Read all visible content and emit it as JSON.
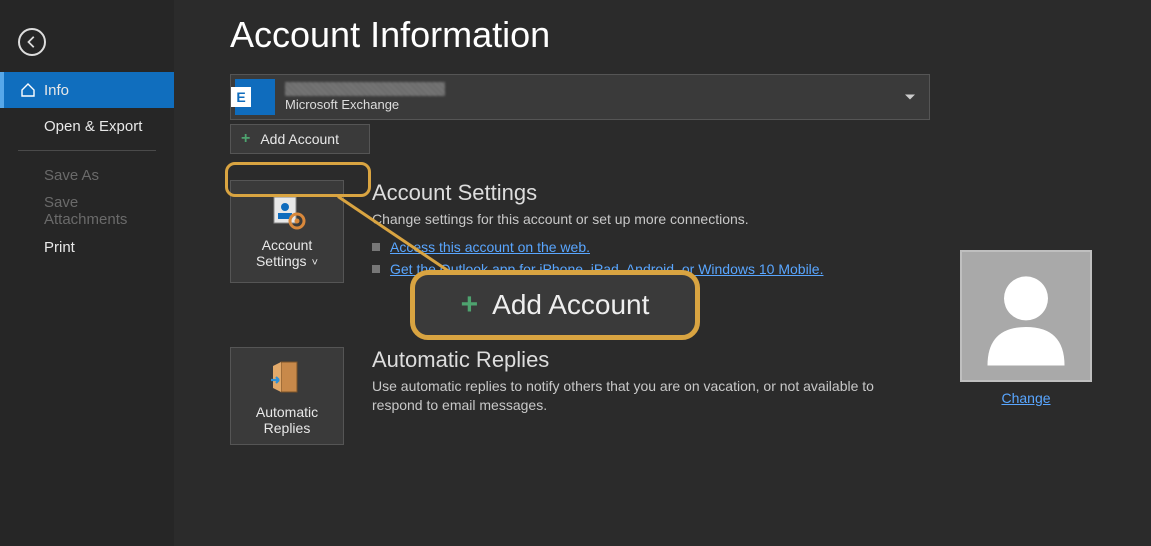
{
  "sidebar": {
    "items": [
      {
        "label": "Info",
        "selected": true,
        "icon": "home-icon"
      },
      {
        "label": "Open & Export"
      },
      {
        "label": "Save As",
        "disabled": true
      },
      {
        "label": "Save Attachments",
        "disabled": true
      },
      {
        "label": "Print"
      }
    ]
  },
  "page": {
    "title": "Account Information"
  },
  "account_selector": {
    "type_label": "Microsoft Exchange"
  },
  "add_account": {
    "label": "Add Account"
  },
  "sections": {
    "account_settings": {
      "button_label": "Account Settings",
      "heading": "Account Settings",
      "description": "Change settings for this account or set up more connections.",
      "bullet_links": [
        "Access this account on the web.",
        "Get the Outlook app for iPhone, iPad, Android, or Windows 10 Mobile."
      ]
    },
    "automatic_replies": {
      "button_label": "Automatic Replies",
      "heading": "Automatic Replies",
      "description": "Use automatic replies to notify others that you are on vacation, or not available to respond to email messages."
    }
  },
  "avatar": {
    "change_label": "Change"
  },
  "callout": {
    "label": "Add Account"
  },
  "colors": {
    "accent": "#106ebe",
    "highlight": "#d9a441",
    "link": "#59a6ff",
    "plus": "#4ea36f"
  }
}
